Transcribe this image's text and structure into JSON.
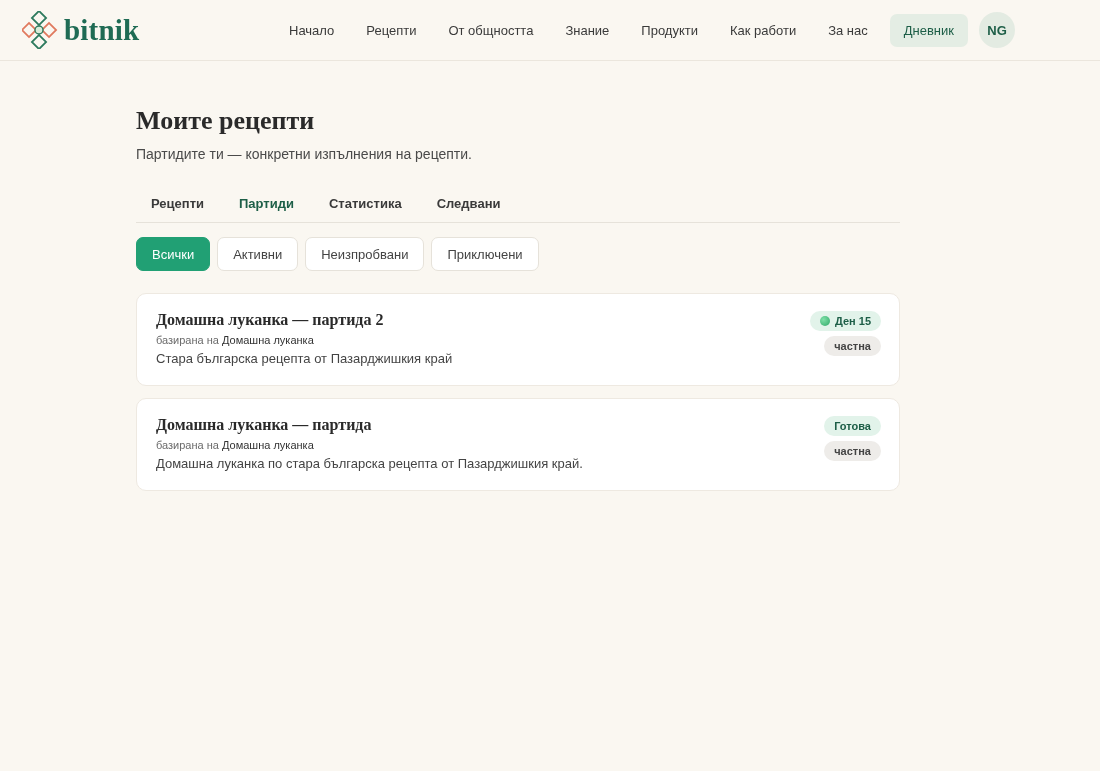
{
  "header": {
    "brand": "bitnik",
    "nav": [
      {
        "label": "Начало",
        "selected": false
      },
      {
        "label": "Рецепти",
        "selected": false
      },
      {
        "label": "От общността",
        "selected": false
      },
      {
        "label": "Знание",
        "selected": false
      },
      {
        "label": "Продукти",
        "selected": false
      },
      {
        "label": "Как работи",
        "selected": false
      },
      {
        "label": "За нас",
        "selected": false
      },
      {
        "label": "Дневник",
        "selected": true
      }
    ],
    "avatar": "NG"
  },
  "page": {
    "title": "Моите рецепти",
    "subtitle": "Партидите ти — конкретни изпълнения на рецепти."
  },
  "tabs": [
    {
      "label": "Рецепти",
      "selected": false
    },
    {
      "label": "Партиди",
      "selected": true
    },
    {
      "label": "Статистика",
      "selected": false
    },
    {
      "label": "Следвани",
      "selected": false
    }
  ],
  "filters": [
    {
      "label": "Всички",
      "selected": true
    },
    {
      "label": "Активни",
      "selected": false
    },
    {
      "label": "Неизпробвани",
      "selected": false
    },
    {
      "label": "Приключени",
      "selected": false
    }
  ],
  "batches": [
    {
      "title": "Домашна луканка — партида 2",
      "based_on": {
        "prefix": "базирана на",
        "recipe": "Домашна луканка"
      },
      "description": "Стара българска рецепта от Пазарджишкия край",
      "status": {
        "kind": "active",
        "label": "Ден 15"
      },
      "visibility": "частна"
    },
    {
      "title": "Домашна луканка — партида",
      "based_on": {
        "prefix": "базирана на",
        "recipe": "Домашна луканка"
      },
      "description": "Домашна луканка по стара българска рецепта от Пазарджишкия край.",
      "status": {
        "kind": "done",
        "label": "Готова"
      },
      "visibility": "частна"
    }
  ]
}
